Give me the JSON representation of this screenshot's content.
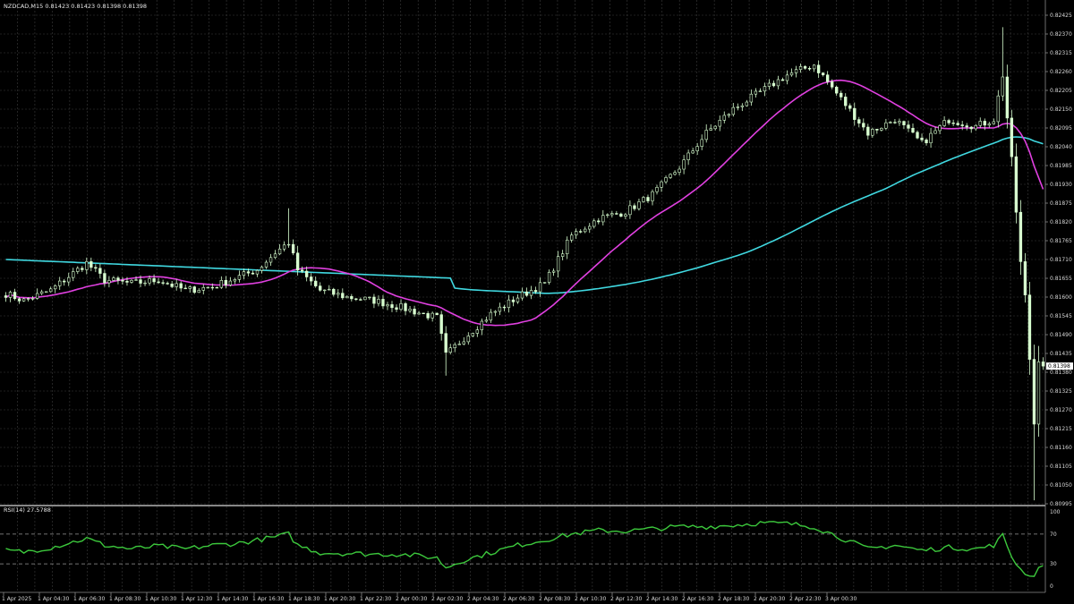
{
  "header": {
    "symbol": "NZDCAD,M15",
    "ohlc": "0.81423 0.81423 0.81398 0.81398"
  },
  "rsi_header": "RSI(14) 27.5788",
  "colors": {
    "background": "#000000",
    "grid": "#3c3c3c",
    "candle": "#d8ffd0",
    "ma_fast": "#e040e0",
    "ma_slow": "#40d8e0",
    "rsi_line": "#3cc83c",
    "separator": "#b4b4b4"
  },
  "chart_data": {
    "type": "candlestick",
    "symbol": "NZDCAD",
    "timeframe": "M15",
    "ylim": [
      0.80995,
      0.82425
    ],
    "yticks": [
      "0.82425",
      "0.82370",
      "0.82315",
      "0.82260",
      "0.82205",
      "0.82150",
      "0.82095",
      "0.82040",
      "0.81985",
      "0.81930",
      "0.81875",
      "0.81820",
      "0.81765",
      "0.81710",
      "0.81655",
      "0.81600",
      "0.81545",
      "0.81490",
      "0.81435",
      "0.81380",
      "0.81325",
      "0.81270",
      "0.81215",
      "0.81160",
      "0.81105",
      "0.81050",
      "0.80995"
    ],
    "current_price": "0.81398",
    "xticks": [
      "1 Apr 2025",
      "1 Apr 04:30",
      "1 Apr 06:30",
      "1 Apr 08:30",
      "1 Apr 10:30",
      "1 Apr 12:30",
      "1 Apr 14:30",
      "1 Apr 16:30",
      "1 Apr 18:30",
      "1 Apr 20:30",
      "1 Apr 22:30",
      "2 Apr 00:30",
      "2 Apr 02:30",
      "2 Apr 04:30",
      "2 Apr 06:30",
      "2 Apr 08:30",
      "2 Apr 10:30",
      "2 Apr 12:30",
      "2 Apr 14:30",
      "2 Apr 16:30",
      "2 Apr 18:30",
      "2 Apr 20:30",
      "2 Apr 22:30",
      "3 Apr 00:30"
    ],
    "close_anchors": [
      [
        0,
        0.8161
      ],
      [
        4,
        0.8159
      ],
      [
        10,
        0.8162
      ],
      [
        18,
        0.817
      ],
      [
        22,
        0.8165
      ],
      [
        28,
        0.8164
      ],
      [
        34,
        0.8165
      ],
      [
        40,
        0.8162
      ],
      [
        46,
        0.8163
      ],
      [
        52,
        0.8166
      ],
      [
        56,
        0.8168
      ],
      [
        60,
        0.8173
      ],
      [
        63,
        0.8176
      ],
      [
        65,
        0.8168
      ],
      [
        70,
        0.8162
      ],
      [
        76,
        0.816
      ],
      [
        82,
        0.8159
      ],
      [
        88,
        0.8157
      ],
      [
        93,
        0.8155
      ],
      [
        96,
        0.8154
      ],
      [
        98,
        0.8143
      ],
      [
        102,
        0.8148
      ],
      [
        108,
        0.8155
      ],
      [
        114,
        0.816
      ],
      [
        120,
        0.8164
      ],
      [
        126,
        0.8178
      ],
      [
        132,
        0.8183
      ],
      [
        138,
        0.8185
      ],
      [
        144,
        0.819
      ],
      [
        150,
        0.8198
      ],
      [
        156,
        0.8208
      ],
      [
        162,
        0.8215
      ],
      [
        168,
        0.822
      ],
      [
        174,
        0.8225
      ],
      [
        180,
        0.8228
      ],
      [
        186,
        0.8218
      ],
      [
        192,
        0.8208
      ],
      [
        198,
        0.8212
      ],
      [
        204,
        0.8205
      ],
      [
        210,
        0.8212
      ],
      [
        216,
        0.821
      ],
      [
        220,
        0.8212
      ],
      [
        222,
        0.8225
      ],
      [
        224,
        0.82
      ],
      [
        226,
        0.817
      ],
      [
        227,
        0.816
      ],
      [
        228,
        0.8142
      ],
      [
        229,
        0.8123
      ],
      [
        230,
        0.8142
      ],
      [
        231,
        0.814
      ]
    ],
    "candle_count": 232,
    "series": [
      {
        "type": "line",
        "color": "#e040e0",
        "period": 21
      },
      {
        "type": "line",
        "color": "#40d8e0",
        "period": 100
      }
    ],
    "rsi": {
      "period": 14,
      "value": "27.5788",
      "ylim": [
        0,
        100
      ],
      "yticks": [
        "100",
        "70",
        "30",
        "0"
      ],
      "levels": [
        70,
        30
      ],
      "anchors": [
        [
          0,
          48
        ],
        [
          4,
          46
        ],
        [
          10,
          52
        ],
        [
          18,
          64
        ],
        [
          22,
          55
        ],
        [
          28,
          50
        ],
        [
          34,
          54
        ],
        [
          40,
          50
        ],
        [
          46,
          55
        ],
        [
          52,
          58
        ],
        [
          60,
          66
        ],
        [
          63,
          70
        ],
        [
          65,
          55
        ],
        [
          70,
          45
        ],
        [
          76,
          44
        ],
        [
          82,
          43
        ],
        [
          88,
          43
        ],
        [
          93,
          40
        ],
        [
          96,
          38
        ],
        [
          98,
          25
        ],
        [
          102,
          35
        ],
        [
          108,
          45
        ],
        [
          114,
          55
        ],
        [
          120,
          62
        ],
        [
          126,
          70
        ],
        [
          132,
          75
        ],
        [
          138,
          74
        ],
        [
          144,
          77
        ],
        [
          150,
          80
        ],
        [
          156,
          80
        ],
        [
          162,
          82
        ],
        [
          168,
          85
        ],
        [
          174,
          84
        ],
        [
          180,
          80
        ],
        [
          186,
          65
        ],
        [
          192,
          50
        ],
        [
          198,
          55
        ],
        [
          204,
          48
        ],
        [
          210,
          52
        ],
        [
          216,
          50
        ],
        [
          220,
          55
        ],
        [
          222,
          68
        ],
        [
          224,
          40
        ],
        [
          226,
          22
        ],
        [
          228,
          15
        ],
        [
          229,
          12
        ],
        [
          230,
          28
        ],
        [
          231,
          28
        ]
      ]
    }
  }
}
